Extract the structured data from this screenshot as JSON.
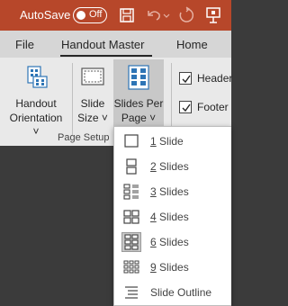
{
  "titlebar": {
    "autosave_label": "AutoSave",
    "toggle_state": "Off",
    "icons": [
      "save-icon",
      "undo-icon",
      "redo-icon",
      "present-icon"
    ],
    "color": "#b7472a"
  },
  "tabs": [
    {
      "label": "File"
    },
    {
      "label": "Handout Master",
      "active": true
    },
    {
      "label": "Home"
    }
  ],
  "ribbon": {
    "handout_orientation": {
      "line1": "Handout",
      "line2": "Orientation ˅"
    },
    "slide_size": {
      "line1": "Slide",
      "line2": "Size ˅"
    },
    "slides_per_page": {
      "line1": "Slides Per",
      "line2": "Page ˅"
    },
    "group_label": "Page Setup",
    "checkboxes": [
      {
        "label": "Header",
        "checked": true
      },
      {
        "label": "Footer",
        "checked": true
      }
    ]
  },
  "dropdown": {
    "items": [
      {
        "accel": "1",
        "rest": " Slide",
        "icon": "one-slide-icon"
      },
      {
        "accel": "2",
        "rest": " Slides",
        "icon": "two-slides-icon"
      },
      {
        "accel": "3",
        "rest": " Slides",
        "icon": "three-slides-icon"
      },
      {
        "accel": "4",
        "rest": " Slides",
        "icon": "four-slides-icon"
      },
      {
        "accel": "6",
        "rest": " Slides",
        "icon": "six-slides-icon",
        "selected": true
      },
      {
        "accel": "9",
        "rest": " Slides",
        "icon": "nine-slides-icon"
      },
      {
        "accel": "",
        "rest": "Slide Outline",
        "icon": "outline-icon"
      }
    ]
  }
}
